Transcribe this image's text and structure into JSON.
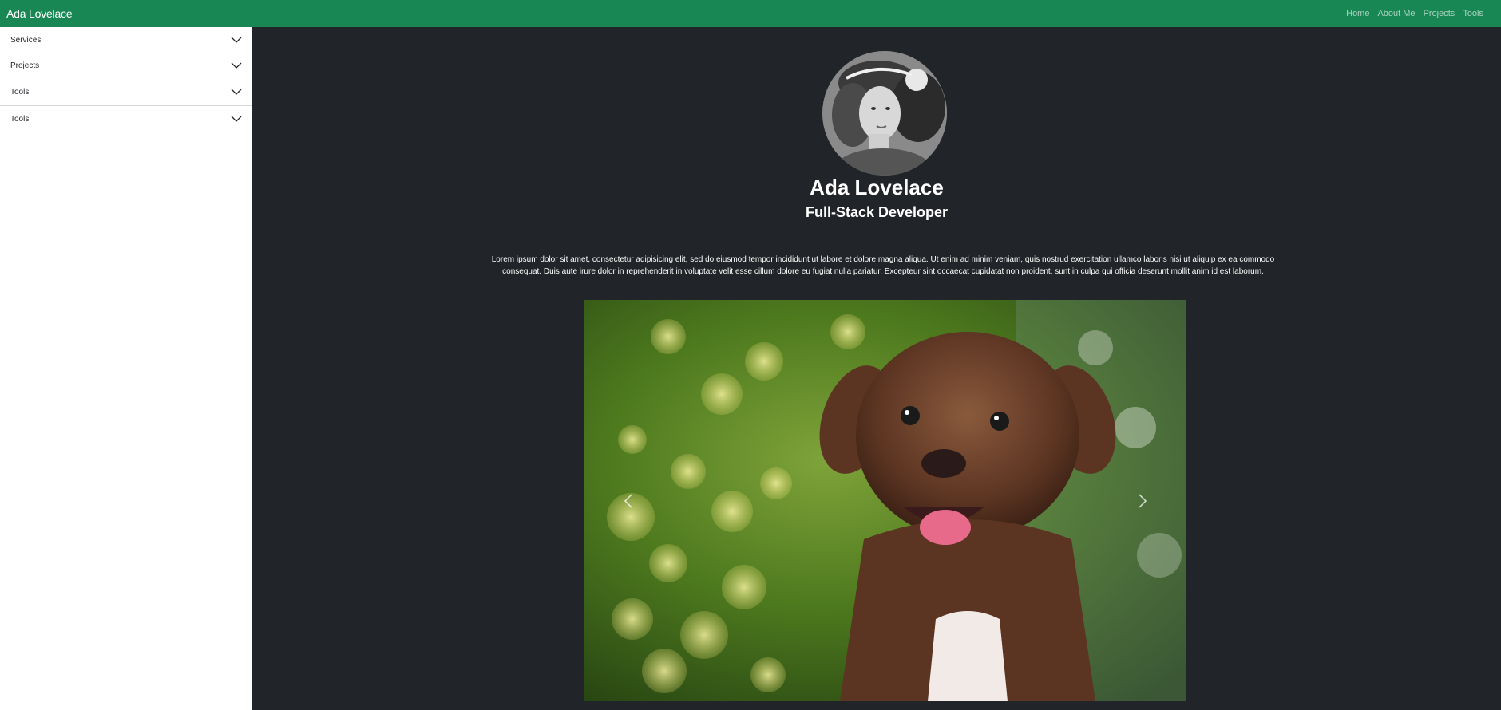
{
  "navbar": {
    "brand": "Ada Lovelace",
    "links": [
      {
        "label": "Home"
      },
      {
        "label": "About Me"
      },
      {
        "label": "Projects"
      },
      {
        "label": "Tools"
      }
    ],
    "color": "#198754"
  },
  "sidebar": {
    "items": [
      {
        "label": "Services",
        "icon": "chevron-down-icon"
      },
      {
        "label": "Projects",
        "icon": "chevron-down-icon"
      },
      {
        "label": "Tools",
        "icon": "chevron-down-icon"
      },
      {
        "label": "Tools",
        "icon": "chevron-down-icon"
      }
    ]
  },
  "profile": {
    "name": "Ada Lovelace",
    "role": "Full-Stack Developer",
    "bio": "Lorem ipsum dolor sit amet, consectetur adipisicing elit, sed do eiusmod tempor incididunt ut labore et dolore magna aliqua. Ut enim ad minim veniam, quis nostrud exercitation ullamco laboris nisi ut aliquip ex ea commodo consequat. Duis aute irure dolor in reprehenderit in voluptate velit esse cillum dolore eu fugiat nulla pariatur. Excepteur sint occaecat cupidatat non proident, sunt in culpa qui officia deserunt mollit anim id est laborum."
  },
  "carousel": {
    "prev_icon": "chevron-left-icon",
    "next_icon": "chevron-right-icon"
  },
  "colors": {
    "main_bg": "#212529",
    "sidebar_bg": "#ffffff"
  }
}
